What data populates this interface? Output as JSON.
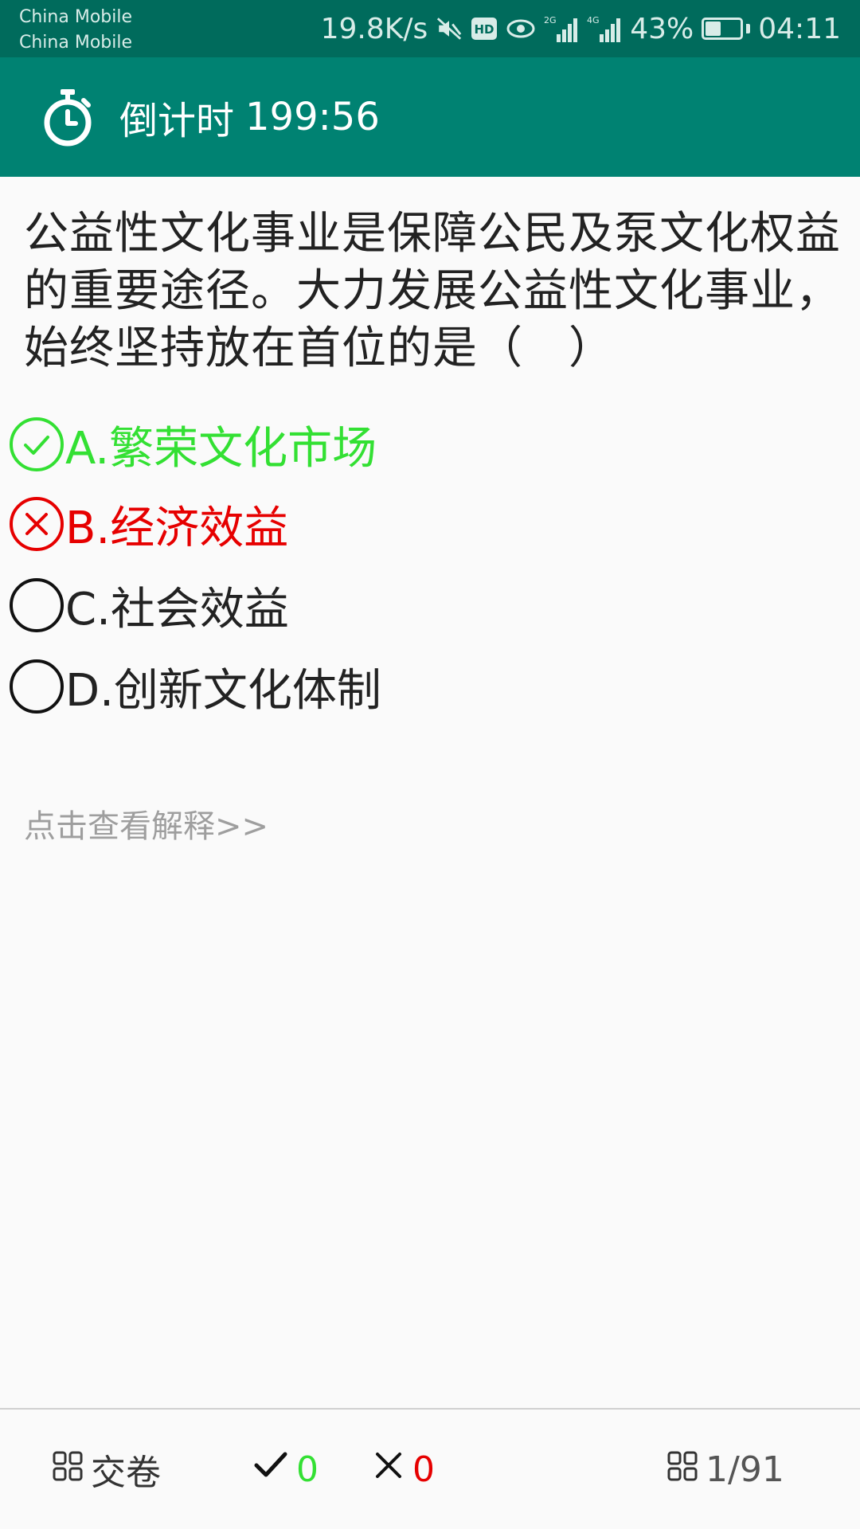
{
  "status_bar": {
    "carrier_1": "China Mobile",
    "carrier_2": "China Mobile",
    "network_speed": "19.8K/s",
    "hd_badge": "HD",
    "signal_1_label": "2G",
    "signal_2_label": "4G",
    "battery_percent": "43%",
    "battery_level": 0.43,
    "time": "04:11"
  },
  "app_bar": {
    "countdown_label": "倒计时",
    "countdown_value": "199:56",
    "color": "#008272"
  },
  "question": {
    "text": "公益性文化事业是保障公民及泵文化权益的重要途径。大力发展公益性文化事业，始终坚持放在首位的是（　）"
  },
  "options": [
    {
      "label": "A.繁荣文化市场",
      "state": "correct",
      "icon": "check-circle-icon",
      "color": "#33e033"
    },
    {
      "label": "B.经济效益",
      "state": "wrong",
      "icon": "x-circle-icon",
      "color": "#e60000"
    },
    {
      "label": "C.社会效益",
      "state": "unselected",
      "icon": "empty-circle-icon",
      "color": "#222222"
    },
    {
      "label": "D.创新文化体制",
      "state": "unselected",
      "icon": "empty-circle-icon",
      "color": "#222222"
    }
  ],
  "explanation_link": "点击查看解释>>",
  "bottom_bar": {
    "submit_label": "交卷",
    "correct_count": "0",
    "wrong_count": "0",
    "progress": "1/91"
  }
}
